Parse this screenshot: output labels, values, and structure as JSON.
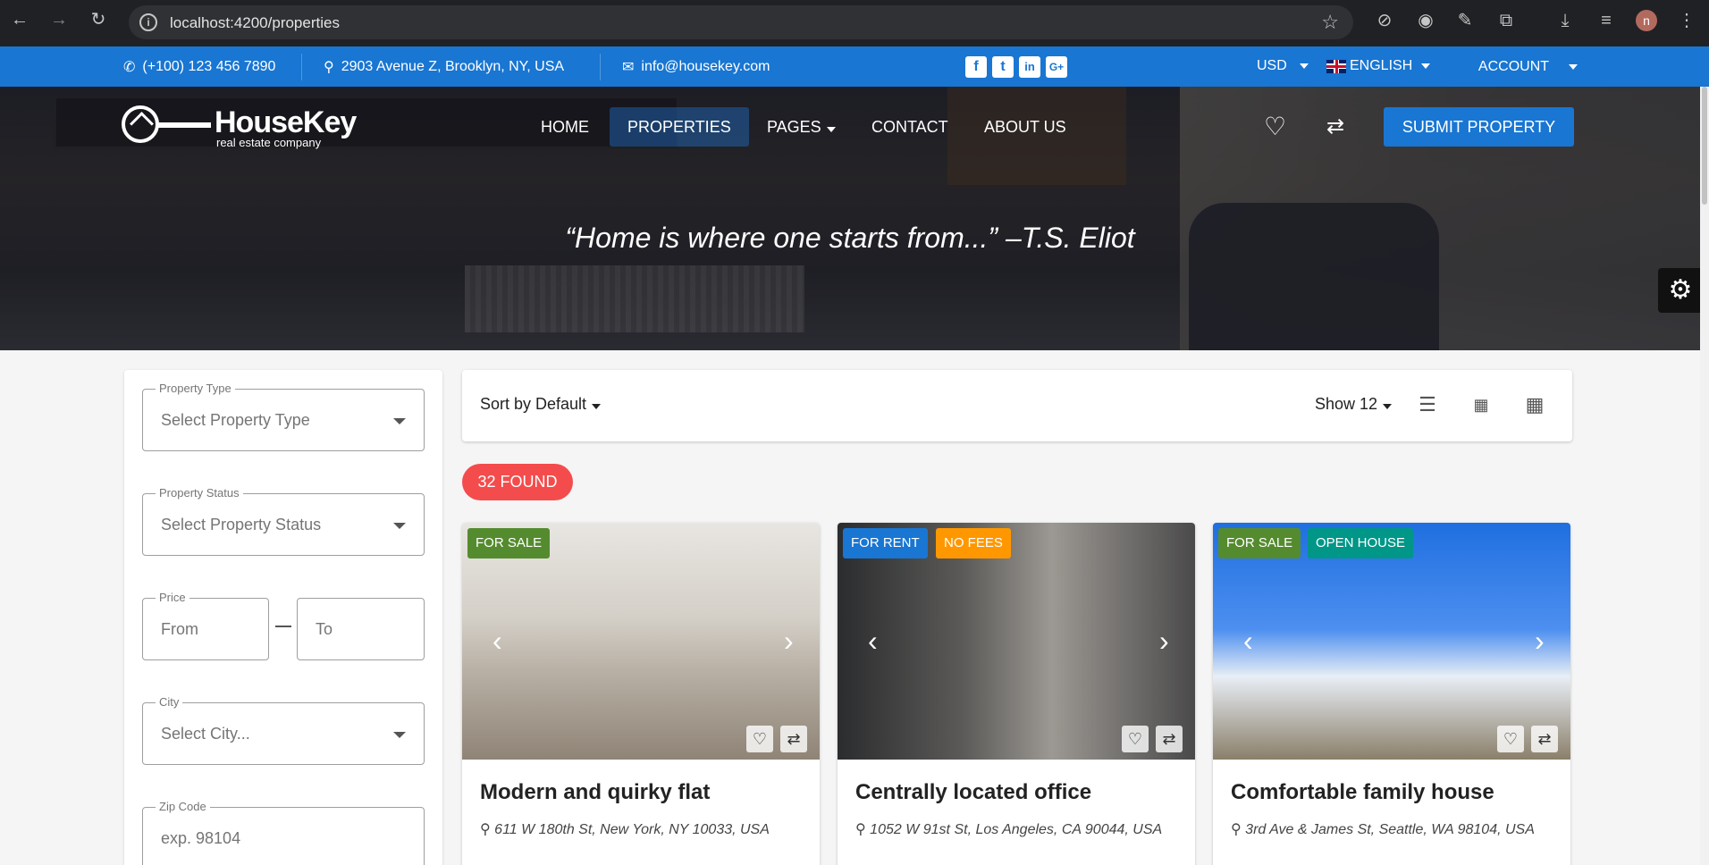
{
  "browser": {
    "url": "localhost:4200/properties",
    "profile_initial": "n"
  },
  "topbar": {
    "phone": "(+100) 123 456 7890",
    "address": "2903 Avenue Z, Brooklyn, NY, USA",
    "email": "info@housekey.com",
    "social": [
      "f",
      "t",
      "in",
      "G+"
    ],
    "currency": "USD",
    "language": "ENGLISH",
    "account": "ACCOUNT"
  },
  "header": {
    "logo_name": "HouseKey",
    "logo_tagline": "real estate company",
    "nav": [
      "HOME",
      "PROPERTIES",
      "PAGES",
      "CONTACT",
      "ABOUT US"
    ],
    "active_nav": "PROPERTIES",
    "submit_label": "SUBMIT PROPERTY"
  },
  "hero": {
    "quote": "“Home is where one starts from...” –T.S. Eliot"
  },
  "filters": {
    "property_type": {
      "label": "Property Type",
      "placeholder": "Select Property Type"
    },
    "property_status": {
      "label": "Property Status",
      "placeholder": "Select Property Status"
    },
    "price": {
      "label": "Price",
      "from": "From",
      "to": "To"
    },
    "city": {
      "label": "City",
      "placeholder": "Select City..."
    },
    "zip": {
      "label": "Zip Code",
      "placeholder": "exp. 98104"
    }
  },
  "toolbar": {
    "sort_label": "Sort by Default",
    "show_label": "Show 12"
  },
  "results": {
    "found_label": "32 FOUND"
  },
  "cards": [
    {
      "title": "Modern and quirky flat",
      "address": "611 W 180th St, New York, NY 10033, USA",
      "badges": [
        "FOR SALE"
      ]
    },
    {
      "title": "Centrally located office",
      "address": "1052 W 91st St, Los Angeles, CA 90044, USA",
      "badges": [
        "FOR RENT",
        "NO FEES"
      ]
    },
    {
      "title": "Comfortable family house",
      "address": "3rd Ave & James St, Seattle, WA 98104, USA",
      "badges": [
        "FOR SALE",
        "OPEN HOUSE"
      ]
    }
  ]
}
